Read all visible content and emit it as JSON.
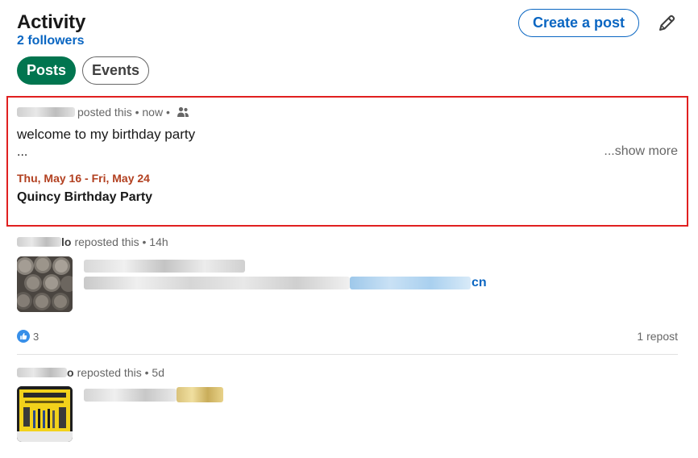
{
  "header": {
    "title": "Activity",
    "followers": "2 followers",
    "create_post_label": "Create a post",
    "edit_icon": "pencil-icon"
  },
  "tabs": [
    {
      "label": "Posts",
      "active": true
    },
    {
      "label": "Events",
      "active": false
    }
  ],
  "posts": [
    {
      "meta": "posted this • now •",
      "visibility_icon": "people-icon",
      "body": "welcome to my birthday party",
      "ellipsis": "...",
      "show_more": "...show more",
      "event_date": "Thu, May 16 - Fri, May 24",
      "event_title": "Quincy Birthday Party",
      "highlighted": true
    },
    {
      "meta_suffix": "lo",
      "meta": "reposted this • 14h",
      "link_tail": "cn",
      "reaction_count": "3",
      "reaction_icon": "thumbs-up-icon",
      "repost_count": "1 repost"
    },
    {
      "meta_suffix": "o",
      "meta": "reposted this • 5d"
    }
  ],
  "colors": {
    "accent_blue": "#0a66c2",
    "active_tab_green": "#01754f",
    "event_date_orange": "#b24020",
    "highlight_red": "#e02020"
  }
}
